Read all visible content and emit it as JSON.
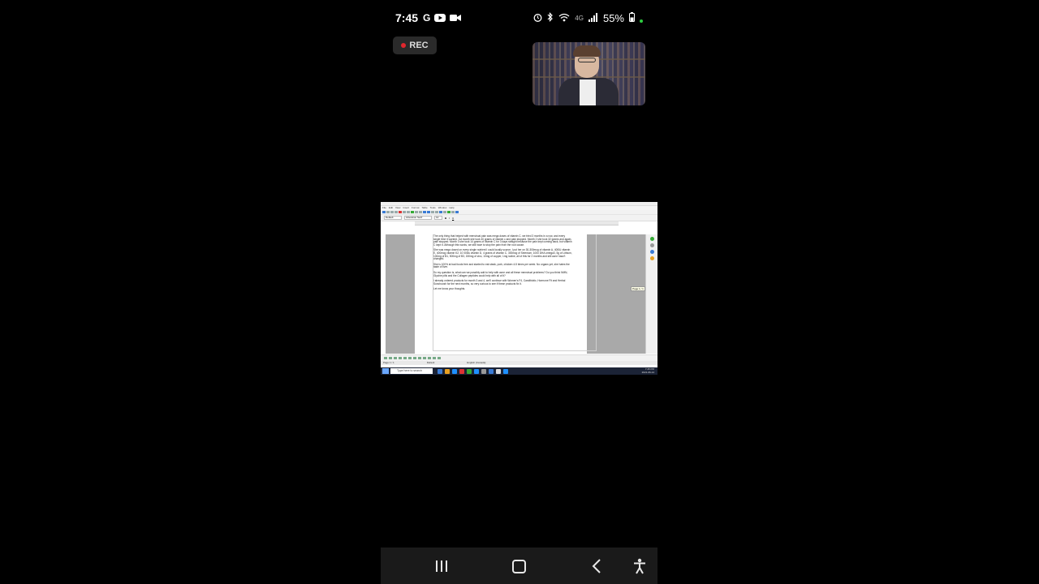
{
  "status_bar": {
    "time": "7:45",
    "google_glyph": "G",
    "app_icons": [
      "youtube-icon",
      "video-call-icon"
    ],
    "signal_label": "4G",
    "battery": "55%",
    "icons": [
      "alarm-icon",
      "bluetooth-icon",
      "wifi-icon",
      "signal-icon",
      "battery-icon"
    ]
  },
  "recording": {
    "label": "REC",
    "color": "#e0262d"
  },
  "screen_share": {
    "document_paragraphs": [
      "The only thing that helped with menstrual pain was mega doses of vitamin C, we tried 3 months in a row, and every single time it worked. 1st month she took 40 grams of vitamin c and pain stopped. Month 2 she took 32 grams and again, pain stopped. Month 3 she took 14 grams of vitamin C for 3 days straight because the pain kept coming back, but vitamin C kept it. Although this works, we still have to stop the pain from the root cause.",
      "She was mega dosed on every single nutrient I could locally source, I put her on 30-300mcg of vitamin A, 400IU vitamin E, 400mcg vitamin K2, 10 000iu vitamin D, 4 grams of vitamin C, 300mcg of Selenium, 1000 DHA omega3, 5g of Lithium, 100mg of B1, 500mg of B3, 150mg of zinc, 10mg of copper, 1mg iodine, all of this for 2 months and still acne hasn't changed.",
      "She is 100% at bad foods free and started to eat steak, pork, chicken 4-5 times per week. No organs yet, she hates the taste of liver.",
      "So my question is, what can we possibly add to help with acne and all these menstrual problems? Do you think NMN, Glycine pills and the Collagen peptides could help with all of it?",
      "I already ordered products for month 3 and 4, we'll continue with Women's F4, Candibiotic, Hormone Fit and Herbal Sunchoosh for the next months, so very curious to see if these products fix it.",
      "Let me know your thoughts."
    ],
    "style_box": "Default",
    "font_box": "Liberation Serif",
    "size_box": "12",
    "menu_items": [
      "File",
      "Edit",
      "View",
      "Insert",
      "Format",
      "Table",
      "Tools",
      "Window",
      "Help"
    ],
    "tooltip": "Page 1 / 1",
    "status_items": [
      "Page 1 / 1",
      "Default",
      "English (Canada)"
    ],
    "taskbar_search": "Type here to search",
    "tray_time": "7:45 PM",
    "tray_date": "2021-06-14"
  },
  "nav_bar": {
    "recent_icon": "recent-apps-icon",
    "home_icon": "home-icon",
    "back_icon": "back-icon",
    "accessibility_icon": "accessibility-icon"
  }
}
